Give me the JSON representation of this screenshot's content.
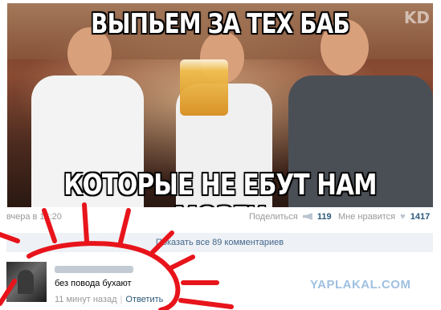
{
  "meme": {
    "top_text": "ВЫПЬЕМ ЗА ТЕХ БАБ",
    "bottom_text": "КОТОРЫЕ НЕ ЕБУТ НАМ МОЗГИ",
    "watermark": "KD"
  },
  "post_meta": {
    "timestamp": "вчера в 16:20",
    "share_label": "Поделиться",
    "share_count": "119",
    "like_label": "Мне нравится",
    "like_count": "1417"
  },
  "comments": {
    "show_all_label": "Показать все 89 комментариев",
    "items": [
      {
        "text": "без повода бухают",
        "time": "11 минут назад",
        "reply_label": "Ответить"
      }
    ]
  },
  "watermark_site": "YAPLAKAL.COM",
  "colors": {
    "link": "#2b587a",
    "meta": "#999999",
    "annotation": "#e8141b",
    "show_all_bg": "#eef1f5"
  },
  "icons": {
    "share": "megaphone-icon",
    "like": "heart-icon"
  }
}
